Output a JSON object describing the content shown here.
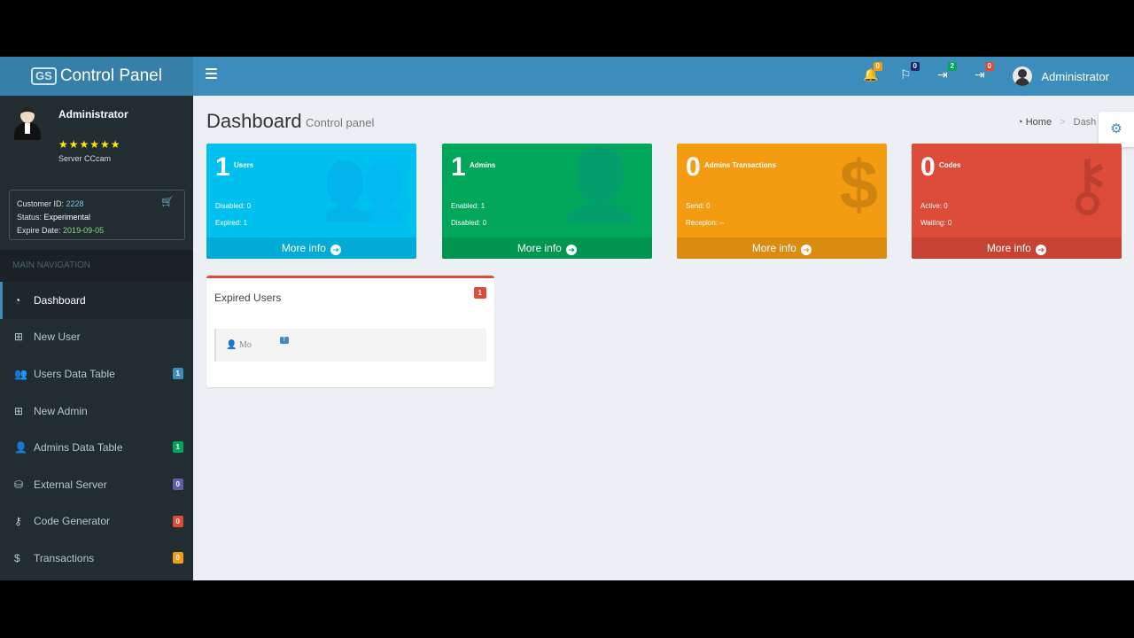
{
  "logo": {
    "badge": "GS",
    "text": "Control Panel"
  },
  "navbar": {
    "icons": [
      {
        "name": "bell-icon",
        "glyph": "🔔",
        "count": "0",
        "color": "#f39c12"
      },
      {
        "name": "flag-icon",
        "glyph": "⚐",
        "count": "0",
        "color": "#1a2b6d"
      },
      {
        "name": "sign-in-icon-1",
        "glyph": "⇥",
        "count": "2",
        "color": "#00a65a"
      },
      {
        "name": "sign-in-icon-2",
        "glyph": "⇥",
        "count": "0",
        "color": "#dd4b39"
      }
    ],
    "user_name": "Administrator"
  },
  "sidebar": {
    "user_name": "Administrator",
    "stars": "★★★★★★",
    "server": "Server CCcam",
    "customer_id_label": "Customer ID:",
    "customer_id": "2228",
    "status_label": "Status:",
    "status": "Experimental",
    "expire_label": "Expire Date:",
    "expire_date": "2019-09-05",
    "nav_header": "MAIN NAVIGATION",
    "items": [
      {
        "label": "Dashboard",
        "icon": "dashboard-icon",
        "glyph": "◔",
        "badge": "",
        "badge_color": ""
      },
      {
        "label": "New User",
        "icon": "plus-square-icon",
        "glyph": "⊞",
        "badge": "",
        "badge_color": ""
      },
      {
        "label": "Users Data Table",
        "icon": "users-icon",
        "glyph": "👥",
        "badge": "1",
        "badge_color": "#3c8dbc"
      },
      {
        "label": "New Admin",
        "icon": "plus-square-outline-icon",
        "glyph": "⊞",
        "badge": "",
        "badge_color": ""
      },
      {
        "label": "Admins Data Table",
        "icon": "user-icon",
        "glyph": "👤",
        "badge": "1",
        "badge_color": "#00a65a"
      },
      {
        "label": "External Server",
        "icon": "server-icon",
        "glyph": "⛁",
        "badge": "0",
        "badge_color": "#605ca8"
      },
      {
        "label": "Code Generator",
        "icon": "key-icon",
        "glyph": "⚷",
        "badge": "0",
        "badge_color": "#dd4b39"
      },
      {
        "label": "Transactions",
        "icon": "dollar-icon",
        "glyph": "$",
        "badge": "0",
        "badge_color": "#f39c12"
      }
    ]
  },
  "content": {
    "title": "Dashboard",
    "subtitle": "Control panel",
    "breadcrumb_home": "Home",
    "breadcrumb_current": "Dash",
    "boxes": [
      {
        "value": "1",
        "label": "Users",
        "line1": "Disabled: 0",
        "line2": "Expired: 1",
        "footer": "More info",
        "color": "#00c0ef",
        "icon": "users-icon"
      },
      {
        "value": "1",
        "label": "Admins",
        "line1": "Enabled: 1",
        "line2": "Disabled: 0",
        "footer": "More info",
        "color": "#00a65a",
        "icon": "user-icon"
      },
      {
        "value": "0",
        "label": "Admins Transactions",
        "line1": "Send: 0",
        "line2": "Recepion: --",
        "footer": "More info",
        "color": "#f39c12",
        "icon": "dollar-icon"
      },
      {
        "value": "0",
        "label": "Codes",
        "line1": "Active: 0",
        "line2": "Waiting: 0",
        "footer": "More info",
        "color": "#dd4b39",
        "icon": "key-icon"
      }
    ],
    "expired_panel": {
      "title": "Expired Users",
      "badge": "1",
      "row_user": "Mo",
      "row_tag": "T"
    }
  }
}
